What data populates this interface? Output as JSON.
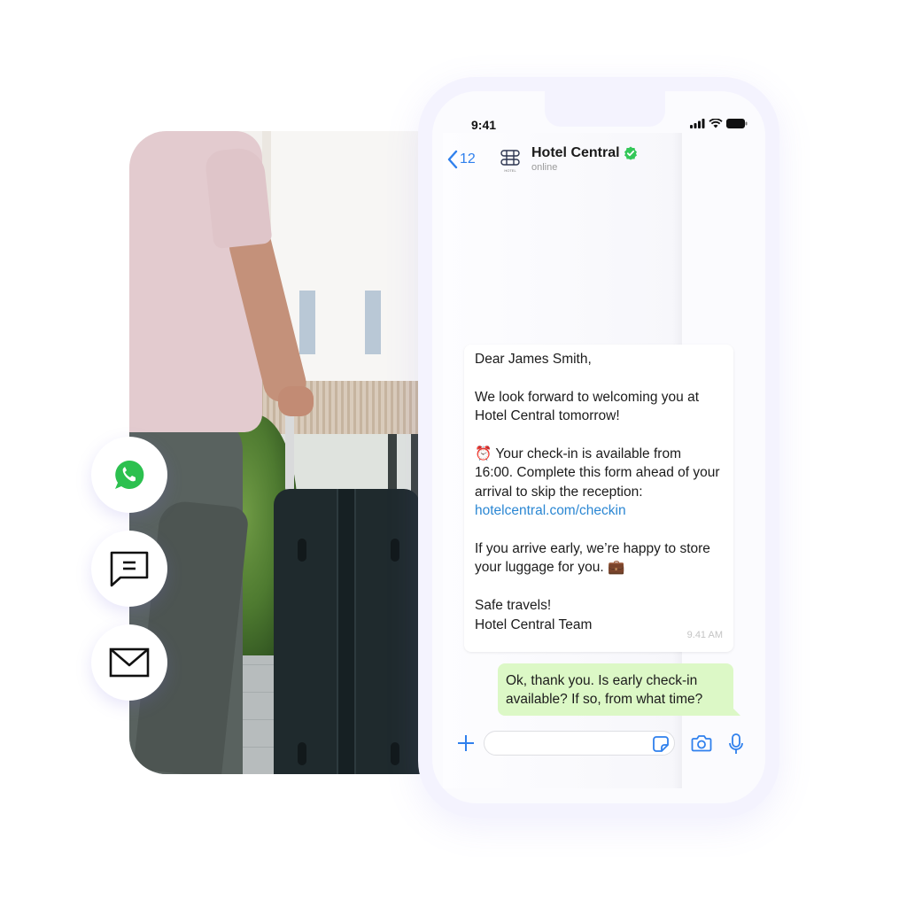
{
  "status_bar": {
    "time": "9:41"
  },
  "chat_header": {
    "back_count": "12",
    "contact_name": "Hotel Central",
    "contact_status": "online",
    "avatar_caption": "HOTEL",
    "verified_color": "#34c759"
  },
  "messages": {
    "incoming": {
      "greeting": "Dear James Smith,",
      "paragraph_1": "We look forward to welcoming you at Hotel Central tomorrow!",
      "paragraph_2_emoji": "⏰",
      "paragraph_2": " Your check-in is available from 16:00. Complete this form ahead of your arrival to skip the reception: ",
      "link": "hotelcentral.com/checkin",
      "paragraph_3": "If you arrive early, we’re happy to store your luggage for you. ",
      "paragraph_3_emoji": "💼",
      "signoff_1": "Safe travels!",
      "signoff_2": "Hotel Central Team",
      "timestamp": "9.41 AM"
    },
    "outgoing": {
      "text": "Ok, thank you. Is early check-in available? If so, from what time?"
    }
  },
  "composer": {
    "input_value": "",
    "input_placeholder": ""
  },
  "channels": [
    {
      "name": "WhatsApp",
      "icon": "whatsapp-icon",
      "color": "#25d366"
    },
    {
      "name": "SMS",
      "icon": "message-icon",
      "color": "#111111"
    },
    {
      "name": "Email",
      "icon": "envelope-icon",
      "color": "#111111"
    }
  ],
  "colors": {
    "accent": "#2f80ed",
    "outgoing_bubble": "#dcf8c6",
    "link": "#2b87d3"
  }
}
